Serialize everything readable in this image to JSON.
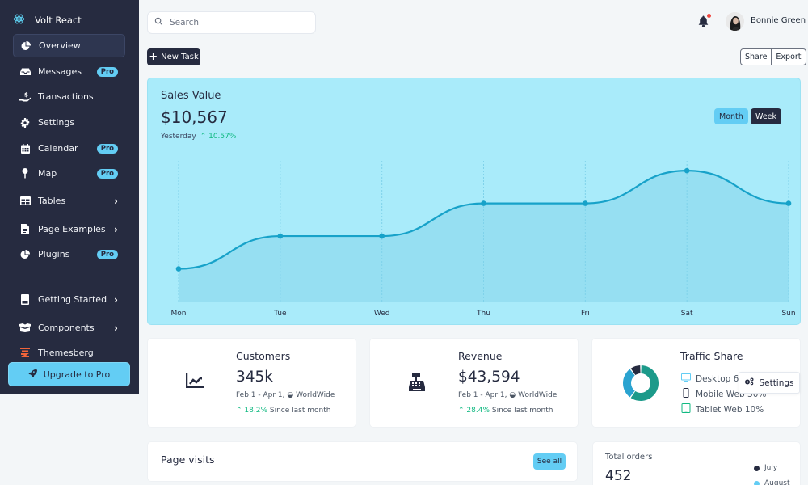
{
  "sidebar": {
    "brand": "Volt React",
    "items": [
      {
        "label": "Overview",
        "icon": "chart-pie-icon",
        "active": true
      },
      {
        "label": "Messages",
        "icon": "inbox-icon",
        "badge": "Pro"
      },
      {
        "label": "Transactions",
        "icon": "hand-dollar-icon"
      },
      {
        "label": "Settings",
        "icon": "gear-icon"
      },
      {
        "label": "Calendar",
        "icon": "calendar-icon",
        "badge": "Pro"
      },
      {
        "label": "Map",
        "icon": "map-pin-icon",
        "badge": "Pro"
      },
      {
        "label": "Tables",
        "icon": "table-icon",
        "chevron": true
      },
      {
        "label": "Page Examples",
        "icon": "file-icon",
        "chevron": true
      },
      {
        "label": "Plugins",
        "icon": "chart-pie-icon",
        "badge": "Pro"
      },
      {
        "label": "Getting Started",
        "icon": "book-icon",
        "chevron": true
      },
      {
        "label": "Components",
        "icon": "boxes-icon",
        "chevron": true
      },
      {
        "label": "Themesberg",
        "icon": "themesberg-logo-icon"
      }
    ],
    "upgrade_label": "Upgrade to Pro"
  },
  "topbar": {
    "search_placeholder": "Search",
    "user_name": "Bonnie Green",
    "has_notification": true
  },
  "toolbar": {
    "new_task_label": "New Task",
    "share_label": "Share",
    "export_label": "Export"
  },
  "sales": {
    "title": "Sales Value",
    "value": "$10,567",
    "period": "Yesterday",
    "change": "10.57%",
    "month_label": "Month",
    "week_label": "Week"
  },
  "chart_data": {
    "type": "area",
    "title": "Sales Value",
    "categories": [
      "Mon",
      "Tue",
      "Wed",
      "Thu",
      "Fri",
      "Sat",
      "Sun"
    ],
    "values": [
      1,
      2,
      2,
      3,
      3,
      4,
      3
    ],
    "ylim": [
      0,
      4.3
    ],
    "xlabel": "",
    "ylabel": "",
    "grid": "vertical-dotted",
    "smooth": true
  },
  "stats": [
    {
      "title": "Customers",
      "value": "345k",
      "period": "Feb 1 - Apr 1,",
      "region": "WorldWide",
      "change": "18.2%",
      "change_suffix": "Since last month",
      "icon": "chart-line-icon"
    },
    {
      "title": "Revenue",
      "value": "$43,594",
      "period": "Feb 1 - Apr 1,",
      "region": "WorldWide",
      "change": "28.4%",
      "change_suffix": "Since last month",
      "icon": "cash-register-icon"
    }
  ],
  "traffic": {
    "title": "Traffic Share",
    "items": [
      {
        "label": "Desktop 60%",
        "device": "desktop-icon",
        "color": "#63cdf4",
        "value": 60
      },
      {
        "label": "Mobile Web 30%",
        "device": "mobile-icon",
        "color": "#262b40",
        "value": 30
      },
      {
        "label": "Tablet Web 10%",
        "device": "tablet-icon",
        "color": "#10b981",
        "value": 10
      }
    ],
    "donut": [
      {
        "name": "Desktop",
        "value": 60,
        "color": "#1c9a8a"
      },
      {
        "name": "Mobile",
        "value": 30,
        "color": "#2aa3d0"
      },
      {
        "name": "Tablet",
        "value": 10,
        "color": "#262b40"
      }
    ]
  },
  "settings_popup_label": "Settings",
  "page_visits": {
    "title": "Page visits",
    "see_all_label": "See all"
  },
  "orders": {
    "title": "Total orders",
    "value": "452",
    "legend": [
      {
        "label": "July",
        "color": "#262b40"
      },
      {
        "label": "August",
        "color": "#63cdf4"
      }
    ]
  }
}
